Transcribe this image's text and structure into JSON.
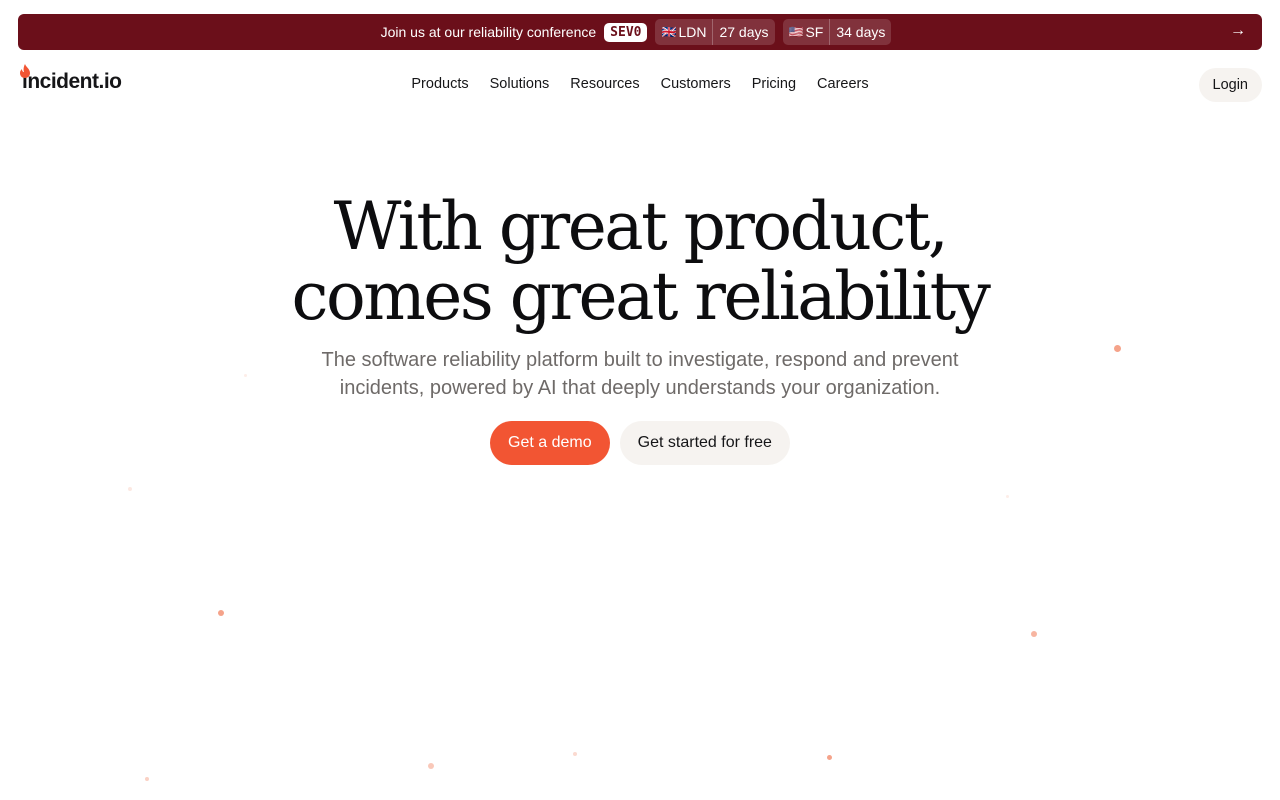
{
  "banner": {
    "text": "Join us at our reliability conference",
    "badge": "SEV0",
    "events": [
      {
        "flag": "🇬🇧",
        "city": "LDN",
        "days": "27 days"
      },
      {
        "flag": "🇺🇸",
        "city": "SF",
        "days": "34 days"
      }
    ],
    "arrow": "→"
  },
  "brand": {
    "name": "incident.io",
    "color": "#f25533"
  },
  "nav": {
    "items": [
      "Products",
      "Solutions",
      "Resources",
      "Customers",
      "Pricing",
      "Careers"
    ],
    "login": "Login"
  },
  "hero": {
    "title_line1": "With great product,",
    "title_line2": "comes great reliability",
    "subtitle": "The software reliability platform built to investigate, respond and prevent incidents, powered by AI that deeply understands your organization.",
    "primary_cta": "Get a demo",
    "secondary_cta": "Get started for free"
  },
  "colors": {
    "banner": "#6b0f1a",
    "accent": "#f25533",
    "button_light": "#f6f3f0"
  }
}
